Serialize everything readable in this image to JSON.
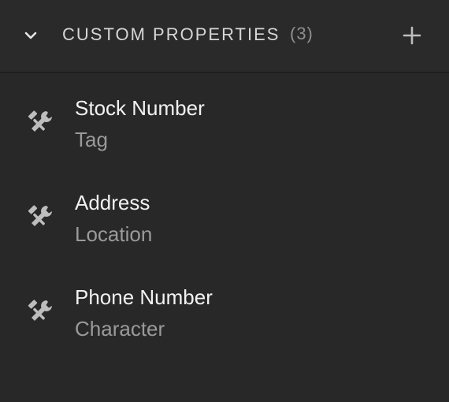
{
  "header": {
    "title": "CUSTOM PROPERTIES",
    "count": "(3)",
    "collapse_icon": "chevron-down-icon",
    "add_icon": "plus-icon"
  },
  "properties": [
    {
      "name": "Stock Number",
      "type": "Tag",
      "icon": "tools-icon"
    },
    {
      "name": "Address",
      "type": "Location",
      "icon": "tools-icon"
    },
    {
      "name": "Phone Number",
      "type": "Character",
      "icon": "tools-icon"
    }
  ],
  "colors": {
    "background": "#282828",
    "header_background": "#2a2a2a",
    "primary_text": "#f2f2f2",
    "secondary_text": "#9a9a9a",
    "icon": "#bdbdbd"
  }
}
